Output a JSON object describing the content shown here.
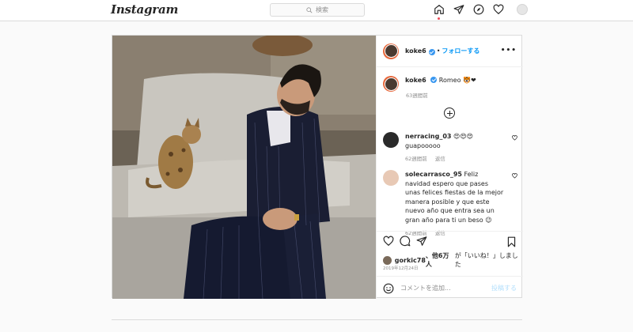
{
  "app": {
    "logo_text": "Instagram"
  },
  "search": {
    "placeholder": "検索",
    "icon": "search-icon"
  },
  "nav": {
    "icons": [
      "home-icon",
      "direct-icon",
      "explore-icon",
      "activity-heart-icon",
      "profile-avatar"
    ],
    "active_dot_color": "#ed4956"
  },
  "post": {
    "author": "koke6",
    "follow_label": "フォローする",
    "separator": "•",
    "more_label": "•••",
    "caption": {
      "username": "koke6",
      "text": "Romeo 🐯❤"
    },
    "caption_time": "63週間前",
    "comments": [
      {
        "username": "nerracing_03",
        "text": "😍😍😍",
        "text2": "guapooooo",
        "time": "62週間前",
        "reply": "返信"
      },
      {
        "username": "solecarrasco_95",
        "text": "Feliz navidad espero que pases unas felices fiestas de la mejor manera posible y que este nuevo año que entra sea un gran año para ti un beso 😉",
        "time": "62週間前",
        "reply": "返信"
      }
    ],
    "likes": {
      "user": "gorkic78",
      "middle": "、他6万人",
      "suffix": "が「いいね！」しました"
    },
    "date": "2019年12月24日",
    "add_comment_placeholder": "コメントを追加...",
    "post_button": "投稿する"
  },
  "colors": {
    "accent": "#0095f6",
    "verified": "#3897f0",
    "border": "#dbdbdb",
    "muted": "#8e8e8e"
  }
}
